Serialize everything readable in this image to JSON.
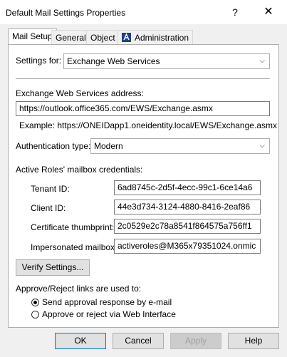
{
  "window": {
    "title": "Default Mail Settings Properties",
    "help_glyph": "?",
    "close_glyph": "✕"
  },
  "tabs": [
    "Mail Setup",
    "General",
    "Object",
    "Administration"
  ],
  "settings_for": {
    "label": "Settings for:",
    "value": "Exchange Web Services"
  },
  "ews": {
    "label": "Exchange Web Services address:",
    "value": "https://outlook.office365.com/EWS/Exchange.asmx",
    "example": "Example: https://ONEIDapp1.oneidentity.local/EWS/Exchange.asmx"
  },
  "auth": {
    "label": "Authentication type:",
    "value": "Modern"
  },
  "credentials": {
    "heading": "Active Roles' mailbox credentials:",
    "tenant_label": "Tenant ID:",
    "tenant_value": "6ad8745c-2d5f-4ecc-99c1-6ce14a6",
    "client_label": "Client ID:",
    "client_value": "44e3d734-3124-4880-8416-2eaf86",
    "cert_label": "Certificate thumbprint:",
    "cert_value": "2c0529e2c78a8541f864575a756ff1",
    "mailbox_label": "Impersonated mailbox:",
    "mailbox_value": "activeroles@M365x79351024.onmic"
  },
  "verify_button": "Verify Settings...",
  "approve": {
    "heading": "Approve/Reject links are used to:",
    "option1": "Send approval response by e-mail",
    "option2": "Approve or reject via Web Interface",
    "selected": 1
  },
  "buttons": {
    "ok": "OK",
    "cancel": "Cancel",
    "apply": "Apply",
    "help": "Help"
  },
  "colors": {
    "accent": "#0078d7",
    "window_bg": "#f0f0f0",
    "panel_bg": "#ffffff"
  }
}
